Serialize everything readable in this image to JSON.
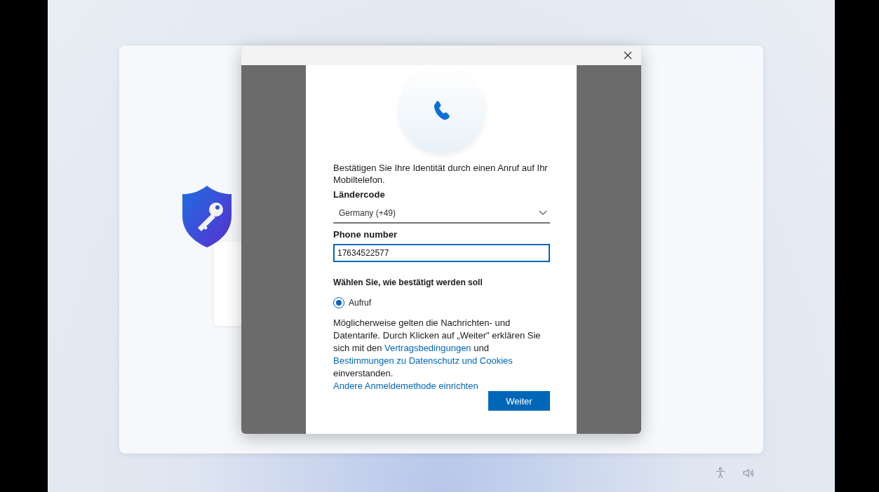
{
  "dialog": {
    "intro": "Bestätigen Sie Ihre Identität durch einen Anruf auf Ihr Mobiltelefon.",
    "country": {
      "label": "Ländercode",
      "value": "Germany (+49)"
    },
    "phone": {
      "label": "Phone number",
      "value": "17634522577",
      "focused": true
    },
    "method": {
      "heading": "Wählen Sie, wie bestätigt werden soll",
      "options": [
        {
          "label": "Aufruf",
          "selected": true
        }
      ]
    },
    "disclaimer": [
      {
        "kind": "text",
        "text": "Möglicherweise gelten die Nachrichten- und Datentarife. Durch Klicken auf „Weiter\" erklären Sie sich mit den "
      },
      {
        "kind": "link",
        "text": "Vertragsbedingungen"
      },
      {
        "kind": "text",
        "text": " und "
      },
      {
        "kind": "link",
        "text": "Bestimmungen zu Datenschutz und Cookies"
      },
      {
        "kind": "text",
        "text": " einverstanden."
      }
    ],
    "other_method": "Andere Anmeldemethode einrichten",
    "button": "Weiter"
  }
}
